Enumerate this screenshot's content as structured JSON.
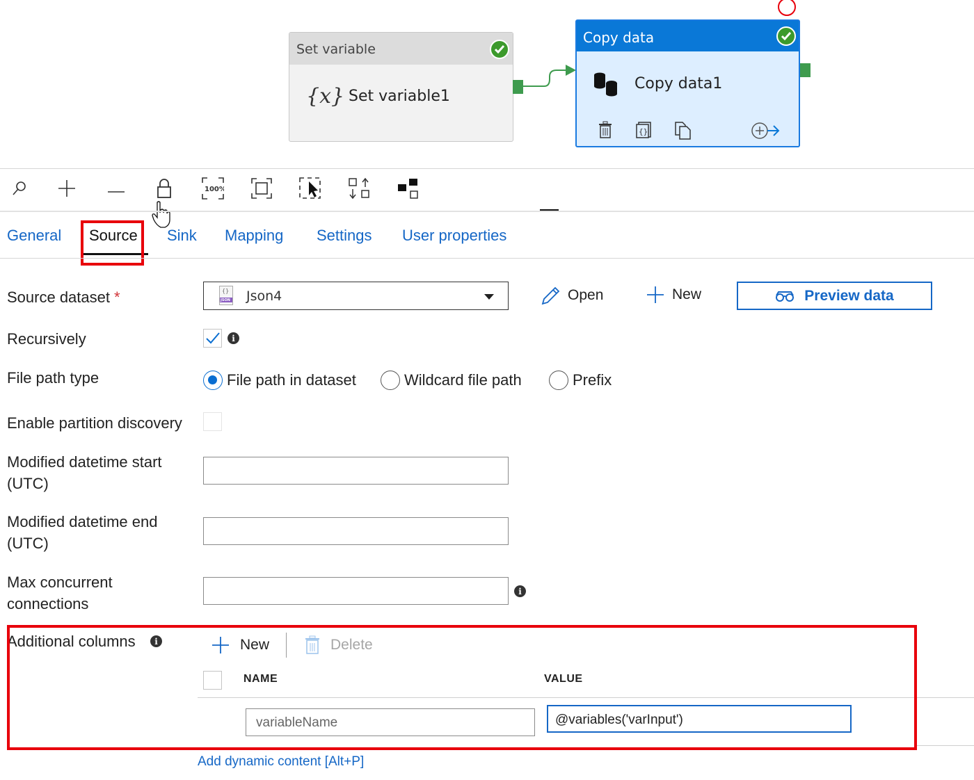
{
  "canvas": {
    "activities": [
      {
        "type_label": "Set variable",
        "name": "Set variable1",
        "icon": "{x}",
        "status": "succeeded"
      },
      {
        "type_label": "Copy data",
        "name": "Copy data1",
        "status": "succeeded"
      }
    ]
  },
  "toolbar": {
    "tools": [
      "search",
      "zoom-in",
      "zoom-out",
      "lock",
      "zoom-100",
      "fit-to-window",
      "select-area",
      "auto-align",
      "show-lines"
    ],
    "zoom_label": "100%"
  },
  "tabs": {
    "items": [
      "General",
      "Source",
      "Sink",
      "Mapping",
      "Settings",
      "User properties"
    ],
    "active": "Source"
  },
  "source": {
    "dataset_label": "Source dataset",
    "required_mark": "*",
    "dataset_value": "Json4",
    "dataset_icon_text": "JSON",
    "open_label": "Open",
    "new_label": "New",
    "preview_label": "Preview data",
    "recursively_label": "Recursively",
    "recursively_checked": true,
    "file_path_type_label": "File path type",
    "file_path_options": [
      "File path in dataset",
      "Wildcard file path",
      "Prefix"
    ],
    "file_path_selected": "File path in dataset",
    "partition_label": "Enable partition discovery",
    "partition_checked": false,
    "mod_start_label": "Modified datetime start (UTC)",
    "mod_start_value": "",
    "mod_end_label": "Modified datetime end (UTC)",
    "mod_end_value": "",
    "max_conn_label": "Max concurrent connections",
    "max_conn_value": ""
  },
  "additional_columns": {
    "label": "Additional columns",
    "new_label": "New",
    "delete_label": "Delete",
    "col_name": "NAME",
    "col_value": "VALUE",
    "rows": [
      {
        "name_placeholder": "variableName",
        "value": "@variables('varInput')"
      }
    ],
    "dynamic_link": "Add dynamic content [Alt+P]"
  },
  "colors": {
    "accent": "#0a78d7",
    "link": "#1567c6",
    "success": "#3c9a2c",
    "highlight": "#e8000b"
  }
}
